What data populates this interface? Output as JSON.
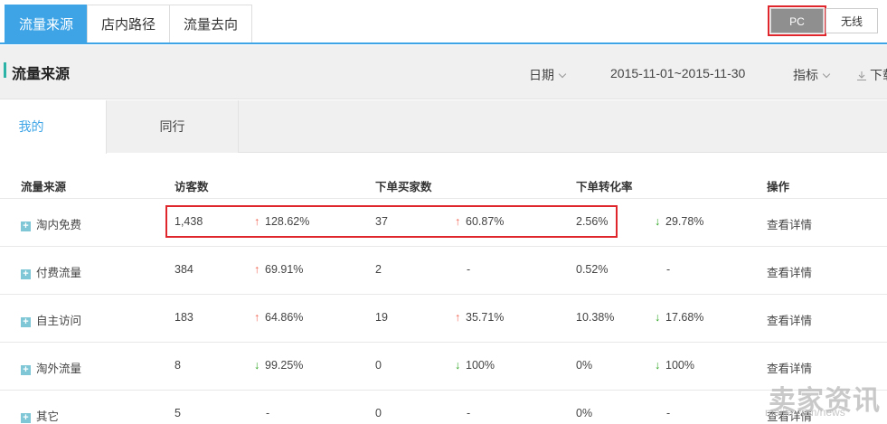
{
  "top_tabs": [
    {
      "label": "流量来源",
      "active": true
    },
    {
      "label": "店内路径",
      "active": false
    },
    {
      "label": "流量去向",
      "active": false
    }
  ],
  "device": {
    "pc_label": "PC",
    "wireless_label": "无线",
    "selected": "PC"
  },
  "section": {
    "title": "流量来源",
    "date_label": "日期",
    "date_range": "2015-11-01~2015-11-30",
    "metric_label": "指标",
    "download_label": "下载"
  },
  "sub_tabs": [
    {
      "label": "我的",
      "active": true
    },
    {
      "label": "同行",
      "active": false
    }
  ],
  "table": {
    "headers": [
      "流量来源",
      "访客数",
      "下单买家数",
      "下单转化率",
      "操作"
    ],
    "rows": [
      {
        "source": "淘内免费",
        "visitors": "1,438",
        "visitors_change": "128.62%",
        "visitors_dir": "up",
        "buyers": "37",
        "buyers_change": "60.87%",
        "buyers_dir": "up",
        "rate": "2.56%",
        "rate_change": "29.78%",
        "rate_dir": "down",
        "action": "查看详情"
      },
      {
        "source": "付费流量",
        "visitors": "384",
        "visitors_change": "69.91%",
        "visitors_dir": "up",
        "buyers": "2",
        "buyers_change": "-",
        "buyers_dir": "none",
        "rate": "0.52%",
        "rate_change": "-",
        "rate_dir": "none",
        "action": "查看详情"
      },
      {
        "source": "自主访问",
        "visitors": "183",
        "visitors_change": "64.86%",
        "visitors_dir": "up",
        "buyers": "19",
        "buyers_change": "35.71%",
        "buyers_dir": "up",
        "rate": "10.38%",
        "rate_change": "17.68%",
        "rate_dir": "down",
        "action": "查看详情"
      },
      {
        "source": "淘外流量",
        "visitors": "8",
        "visitors_change": "99.25%",
        "visitors_dir": "down",
        "buyers": "0",
        "buyers_change": "100%",
        "buyers_dir": "down",
        "rate": "0%",
        "rate_change": "100%",
        "rate_dir": "down",
        "action": "查看详情"
      },
      {
        "source": "其它",
        "visitors": "5",
        "visitors_change": "-",
        "visitors_dir": "none",
        "buyers": "0",
        "buyers_change": "-",
        "buyers_dir": "none",
        "rate": "0%",
        "rate_change": "-",
        "rate_dir": "none",
        "action": "查看详情"
      }
    ]
  },
  "colors": {
    "accent": "#3ea4e6",
    "up": "#f26451",
    "down": "#2aa31e",
    "highlight": "#e0262d"
  },
  "watermark": {
    "text": "卖家资讯",
    "sub": "maijia.com/news"
  }
}
